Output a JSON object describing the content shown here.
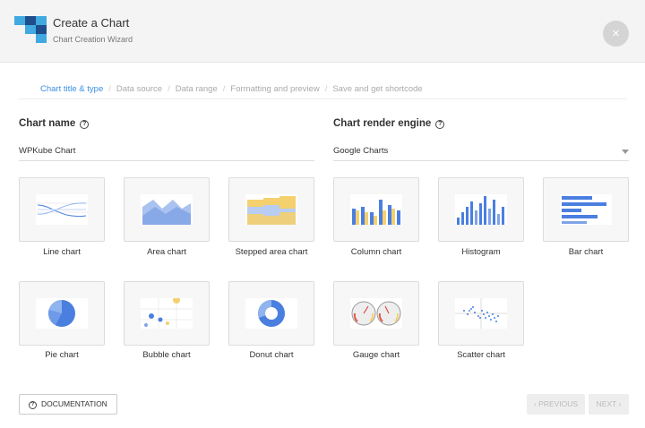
{
  "header": {
    "title": "Create a Chart",
    "subtitle": "Chart Creation Wizard",
    "close_symbol": "×"
  },
  "steps": [
    {
      "label": "Chart title & type",
      "active": true
    },
    {
      "label": "Data source",
      "active": false
    },
    {
      "label": "Data range",
      "active": false
    },
    {
      "label": "Formatting and preview",
      "active": false
    },
    {
      "label": "Save and get shortcode",
      "active": false
    }
  ],
  "step_separator": "/",
  "chart_name": {
    "label": "Chart name",
    "value": "WPKube Chart"
  },
  "render_engine": {
    "label": "Chart render engine",
    "value": "Google Charts"
  },
  "help_symbol": "?",
  "chart_types": [
    {
      "label": "Line chart",
      "icon": "line-chart-icon"
    },
    {
      "label": "Area chart",
      "icon": "area-chart-icon"
    },
    {
      "label": "Stepped area chart",
      "icon": "stepped-area-chart-icon"
    },
    {
      "label": "Column chart",
      "icon": "column-chart-icon"
    },
    {
      "label": "Histogram",
      "icon": "histogram-icon"
    },
    {
      "label": "Bar chart",
      "icon": "bar-chart-icon"
    },
    {
      "label": "Pie chart",
      "icon": "pie-chart-icon"
    },
    {
      "label": "Bubble chart",
      "icon": "bubble-chart-icon"
    },
    {
      "label": "Donut chart",
      "icon": "donut-chart-icon"
    },
    {
      "label": "Gauge chart",
      "icon": "gauge-chart-icon"
    },
    {
      "label": "Scatter chart",
      "icon": "scatter-chart-icon"
    }
  ],
  "footer": {
    "documentation": "DOCUMENTATION",
    "previous": "‹ PREVIOUS",
    "next": "NEXT ›"
  },
  "colors": {
    "accent": "#3a8ee6",
    "chart_blue": "#4a7fe0",
    "chart_yellow": "#f4d06f",
    "logo_dark": "#1f4e8c",
    "logo_light": "#3fa9e0"
  }
}
